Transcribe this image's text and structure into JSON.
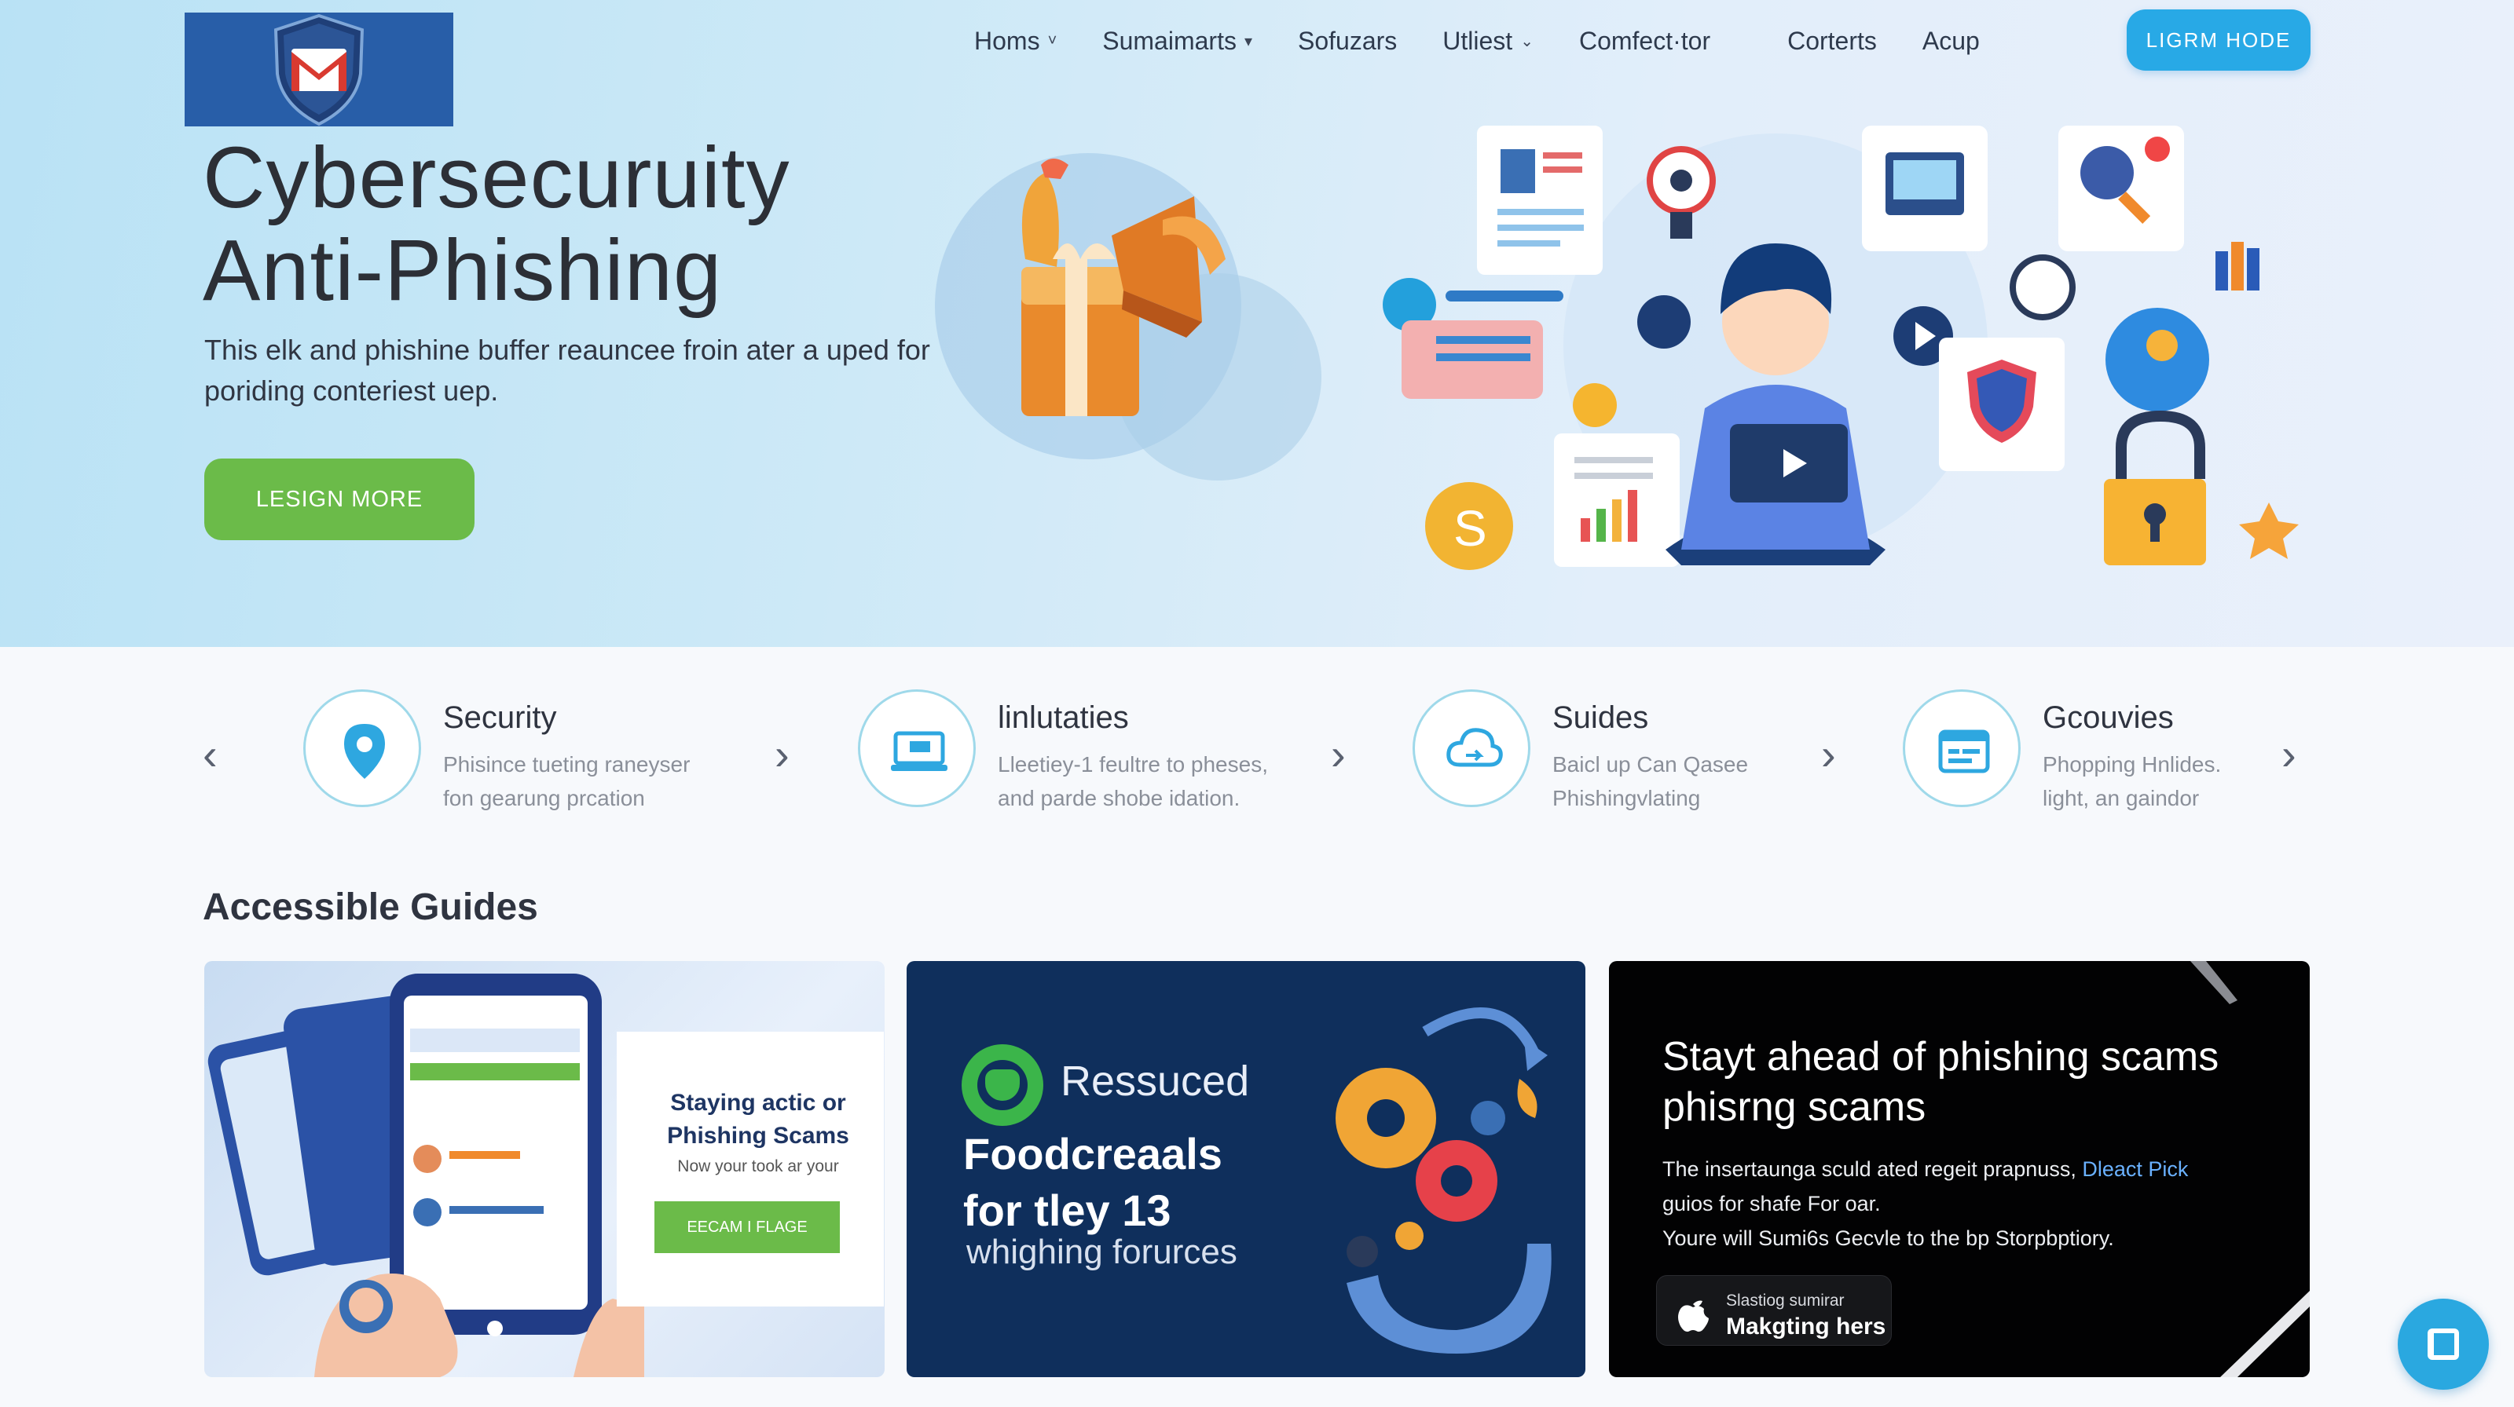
{
  "brand": {
    "logo_icon": "gmail-shield-logo"
  },
  "nav": {
    "items": [
      {
        "label": "Homs",
        "has_dropdown": true,
        "chev": "˅"
      },
      {
        "label": "Sumaimarts",
        "has_dropdown": true,
        "chev": "▾"
      },
      {
        "label": "Sofuzars",
        "has_dropdown": false,
        "chev": ""
      },
      {
        "label": "Utliest",
        "has_dropdown": true,
        "chev": "⌄"
      },
      {
        "label": "Comfect·tor",
        "has_dropdown": false,
        "chev": ""
      }
    ],
    "items_right": [
      {
        "label": "Corterts"
      },
      {
        "label": "Acup"
      }
    ],
    "cta_label": "LIGRM HODE"
  },
  "hero": {
    "title_line1": "Cybersecuruity",
    "title_line2": "Anti-Phishing",
    "description": "This elk and phishine buffer reauncee froin ater a uped for poriding conteriest uep.",
    "button_label": "LESIGN MORE"
  },
  "features": [
    {
      "title": "Security",
      "desc_line1": "Phisince tueting raneyser",
      "desc_line2": "fon gearung prcation",
      "icon": "location-pin-icon"
    },
    {
      "title": "linlutaties",
      "desc_line1": "Lleetiey-1 feultre to pheses,",
      "desc_line2": "and parde shobe idation.",
      "icon": "laptop-shield-icon"
    },
    {
      "title": "Suides",
      "desc_line1": "Baicl up Can Qasee",
      "desc_line2": "Phishingvlating",
      "icon": "cloud-sync-icon"
    },
    {
      "title": "Gcouvies",
      "desc_line1": "Phopping Hnlides.",
      "desc_line2": "light, an gaindor",
      "icon": "calendar-icon"
    }
  ],
  "guides": {
    "heading": "Accessible Guides",
    "card1": {
      "title": "Staying actic or Phishing Scams",
      "subtitle": "Now your took ar your",
      "button_label": "EECAM I FLAGE"
    },
    "card2": {
      "brand": "Ressuced",
      "title_line1": "Foodcreaals",
      "title_line2": "for tley 13",
      "subtitle": "whighing forurces"
    },
    "card3": {
      "title": "Stayt ahead of phishing scams phisrng scams",
      "body_line1_a": "The insertaunga sculd ated regeit prapnuss,",
      "body_line1_link": "Dleact Pick",
      "body_line2": "guios for shafe For oar.",
      "body_line3": "Youre will Sumi6s Gecvle to the bp Storpbptiory.",
      "badge_small": "Slastiog sumirar",
      "badge_big": "Makgting hers"
    }
  },
  "colors": {
    "accent_blue": "#28a9e6",
    "cta_green": "#6bbb49",
    "card2_bg": "#0f2f5c",
    "card3_bg": "#020203"
  }
}
